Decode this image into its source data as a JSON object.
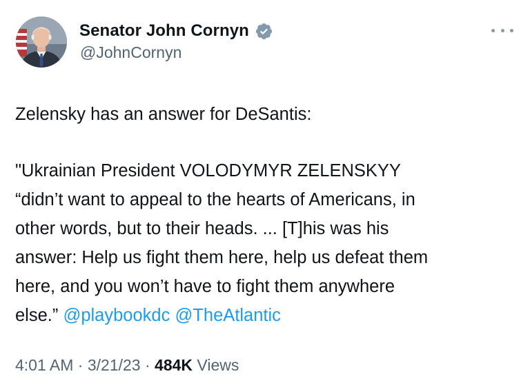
{
  "author": {
    "display_name": "Senator John Cornyn",
    "handle": "@JohnCornyn",
    "verified_icon": "verified-badge-icon",
    "avatar": "profile-photo"
  },
  "tweet": {
    "intro": "Zelensky has an answer for DeSantis:",
    "quote_lines": [
      "\"Ukrainian President VOLODYMYR ZELENSKYY",
      "“didn’t want to appeal to the hearts of Americans, in",
      "other words, but to their heads. ... [T]his was his",
      "answer: Help us fight them here, help us defeat them",
      "here, and you won’t have to fight them anywhere"
    ],
    "last_line_text": "else.” ",
    "mentions": [
      "@playbookdc",
      "@TheAtlantic"
    ]
  },
  "meta": {
    "time": "4:01 AM",
    "separator": "·",
    "date": "3/21/23",
    "views_count": "484K",
    "views_label": "Views"
  },
  "colors": {
    "text": "#0f1419",
    "secondary": "#536471",
    "link": "#1d9bf0",
    "verified": "#829aab"
  },
  "icons": {
    "more": "more-options-icon"
  }
}
